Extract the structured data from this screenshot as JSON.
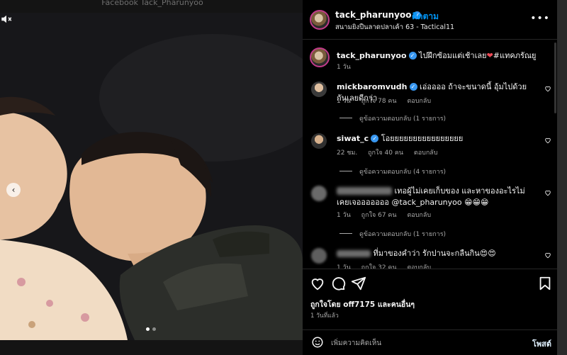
{
  "watermark": "Facebook Tack_Pharunyoo",
  "media": {
    "slides": 2,
    "active_slide": 1
  },
  "header": {
    "username": "tack_pharunyoo",
    "follow_label": "ติดตาม",
    "location": "สนามยิงปืนลาดปลาเค้า 63 - Tactical11",
    "more_label": "•••"
  },
  "caption": {
    "username": "tack_pharunyoo",
    "text": "ไปฝึกซ้อมแต่เช้าเลย",
    "hashtag": "#แทคภรัณยู",
    "time": "1 วัน"
  },
  "comments": [
    {
      "username": "mickbaromvudh",
      "verified": true,
      "text": "เอ่ออออ ถ้าจะขนาดนี้ อุ้มไปด้วยกันเลยดีกว่า",
      "time": "1 วัน",
      "likes": "ถูกใจ 78 คน",
      "reply": "ตอบกลับ",
      "replies_label": "ดูข้อความตอบกลับ (1 รายการ)"
    },
    {
      "username": "siwat_c",
      "verified": true,
      "text": "โอยยยยยยยยยยยยยยยย",
      "time": "22 ชม.",
      "likes": "ถูกใจ 40 คน",
      "reply": "ตอบกลับ",
      "replies_label": "ดูข้อความตอบกลับ (4 รายการ)"
    },
    {
      "username": "",
      "verified": false,
      "text": "เทอผู้ไม่เคยเก็บของ และหาของอะไรไม่เคยเจอออออออ @tack_pharunyoo 😁😁😁",
      "time": "1 วัน",
      "likes": "ถูกใจ 67 คน",
      "reply": "ตอบกลับ",
      "replies_label": "ดูข้อความตอบกลับ (1 รายการ)"
    },
    {
      "username": "",
      "verified": false,
      "text": "ที่มาของคำว่า รักปานจะกลืนกิน😍😍",
      "time": "1 วัน",
      "likes": "ถูกใจ 32 คน",
      "reply": "ตอบกลับ",
      "replies_label": ""
    }
  ],
  "actions": {
    "liked_by": "ถูกใจโดย off7175 และคนอื่นๆ",
    "posted_ago": "1 วันที่แล้ว"
  },
  "composer": {
    "placeholder": "เพิ่มความคิดเห็น",
    "post_label": "โพสต์"
  },
  "colors": {
    "accent_blue": "#0095f6",
    "verified_blue": "#3897f0",
    "heart_red": "#ed4956",
    "panel_bg": "#000000"
  }
}
